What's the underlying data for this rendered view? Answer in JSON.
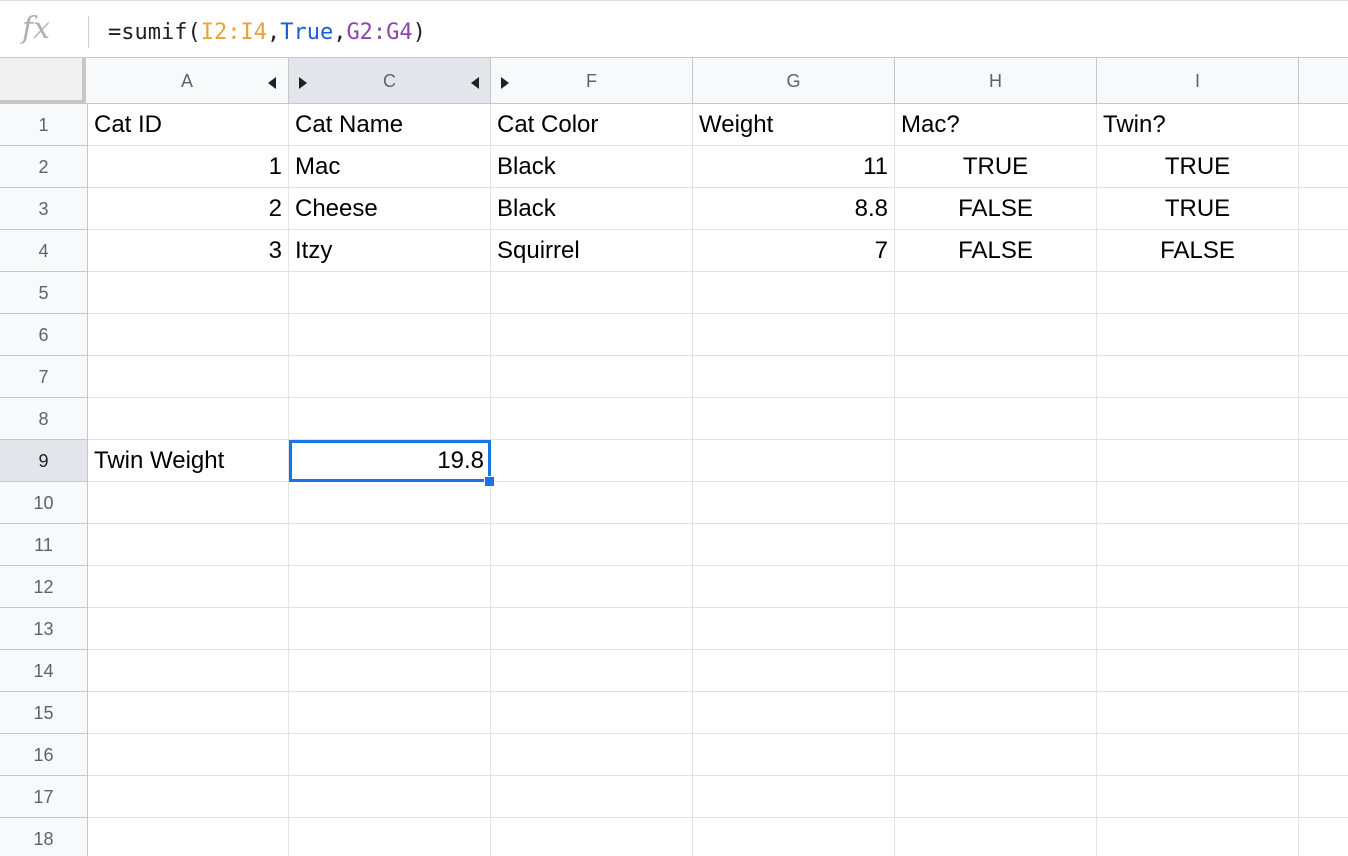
{
  "formula_bar": {
    "fx_label": "fx",
    "formula": {
      "prefix": "=sumif(",
      "range1": "I2:I4",
      "sep1": ",",
      "criterion": "True",
      "sep2": ",",
      "range2": "G2:G4",
      "suffix": ")"
    }
  },
  "columns": [
    "A",
    "C",
    "F",
    "G",
    "H",
    "I"
  ],
  "rows": [
    "1",
    "2",
    "3",
    "4",
    "5",
    "6",
    "7",
    "8",
    "9",
    "10",
    "11",
    "12",
    "13",
    "14",
    "15",
    "16",
    "17",
    "18"
  ],
  "cells": {
    "r1": [
      "Cat ID",
      "Cat Name",
      "Cat Color",
      "Weight",
      "Mac?",
      "Twin?"
    ],
    "r2": [
      "1",
      "Mac",
      "Black",
      "11",
      "TRUE",
      "TRUE"
    ],
    "r3": [
      "2",
      "Cheese",
      "Black",
      "8.8",
      "FALSE",
      "TRUE"
    ],
    "r4": [
      "3",
      "Itzy",
      "Squirrel",
      "7",
      "FALSE",
      "FALSE"
    ],
    "r9": [
      "Twin Weight",
      "19.8",
      "",
      "",
      "",
      ""
    ]
  },
  "selected_cell": "C9",
  "colors": {
    "selection": "#1a73e8",
    "range1": "#e8a23a",
    "criterion": "#1a5fd6",
    "range2": "#8e44ad"
  }
}
